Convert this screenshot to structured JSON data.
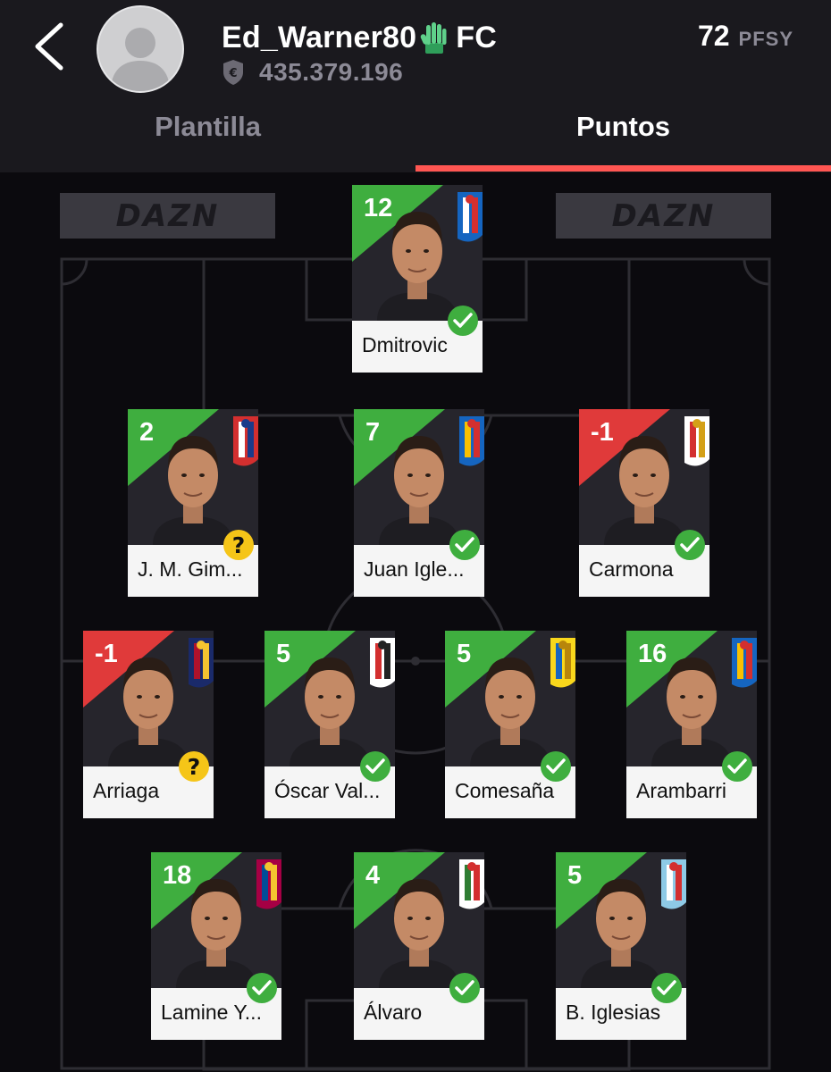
{
  "header": {
    "team_name": "Ed_Warner80",
    "team_suffix": "FC",
    "team_value": "435.379.196",
    "points": "72",
    "points_unit": "PFSY"
  },
  "tabs": [
    {
      "label": "Plantilla",
      "active": false
    },
    {
      "label": "Puntos",
      "active": true
    }
  ],
  "sponsor": {
    "left": "DAZN",
    "right": "DAZN"
  },
  "colors": {
    "accent": "#ff5652",
    "positive": "#3fae3f",
    "negative": "#e03a3a",
    "check": "#3fae3f",
    "doubt": "#f5c518"
  },
  "players": [
    {
      "name": "Dmitrovic",
      "points": "12",
      "club": "espanyol",
      "status": "check",
      "positive": true
    },
    {
      "name": "J. M. Gim...",
      "points": "2",
      "club": "atletico",
      "status": "doubt",
      "positive": true
    },
    {
      "name": "Juan Igle...",
      "points": "7",
      "club": "getafe",
      "status": "check",
      "positive": true
    },
    {
      "name": "Carmona",
      "points": "-1",
      "club": "sevilla",
      "status": "check",
      "positive": false
    },
    {
      "name": "Arriaga",
      "points": "-1",
      "club": "levante",
      "status": "doubt",
      "positive": false
    },
    {
      "name": "Óscar Val...",
      "points": "5",
      "club": "rayo",
      "status": "check",
      "positive": true
    },
    {
      "name": "Comesaña",
      "points": "5",
      "club": "villarreal",
      "status": "check",
      "positive": true
    },
    {
      "name": "Arambarri",
      "points": "16",
      "club": "getafe",
      "status": "check",
      "positive": true
    },
    {
      "name": "Lamine Y...",
      "points": "18",
      "club": "barcelona",
      "status": "check",
      "positive": true
    },
    {
      "name": "Álvaro",
      "points": "4",
      "club": "elche",
      "status": "check",
      "positive": true
    },
    {
      "name": "B. Iglesias",
      "points": "5",
      "club": "celta",
      "status": "check",
      "positive": true
    }
  ]
}
